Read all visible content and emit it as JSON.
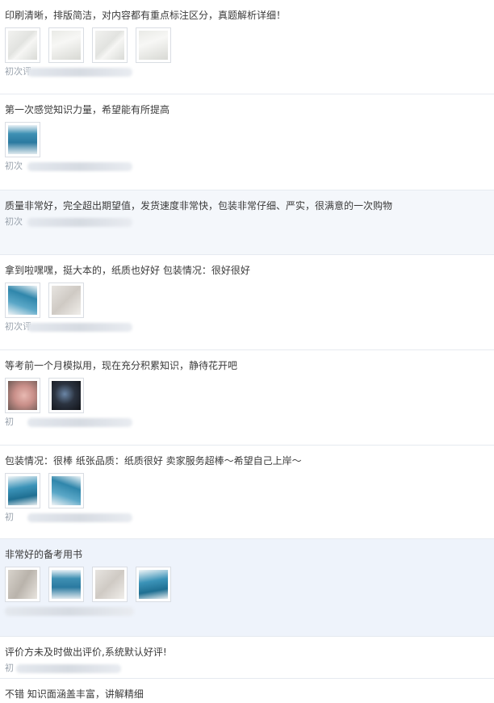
{
  "reviews": [
    {
      "text": "印刷清晰，排版简洁，对内容都有重点标注区分，真题解析详细！",
      "meta_prefix": "初次评",
      "images": [
        "t-white",
        "t-white2",
        "t-white",
        "t-white2"
      ]
    },
    {
      "text": "第一次感觉知识力量，希望能有所提高",
      "meta_prefix": "初次",
      "images": [
        "t-blue"
      ]
    },
    {
      "text": "质量非常好，完全超出期望值，发货速度非常快，包装非常仔细、严实，很满意的一次购物",
      "meta_prefix": "初次",
      "images": []
    },
    {
      "text": "拿到啦嘿嘿，挺大本的，纸质也好好 包装情况：很好很好",
      "meta_prefix": "初次评",
      "images": [
        "t-blue2",
        "t-paper"
      ]
    },
    {
      "text": "等考前一个月模拟用，现在充分积累知识，静待花开吧",
      "meta_prefix": "初",
      "images": [
        "t-pink",
        "t-dark"
      ]
    },
    {
      "text": "包装情况：很棒 纸张品质：纸质很好 卖家服务超棒～希望自己上岸～",
      "meta_prefix": "初",
      "images": [
        "t-blue3",
        "t-blue2"
      ]
    },
    {
      "text": "非常好的备考用书",
      "meta_prefix": "",
      "images": [
        "t-book",
        "t-blue",
        "t-paper",
        "t-blue3"
      ]
    },
    {
      "text": "评价方未及时做出评价,系统默认好评!",
      "meta_prefix": "初",
      "images": []
    },
    {
      "text": "不错 知识面涵盖丰富，讲解精细",
      "meta_prefix": "",
      "images": []
    }
  ]
}
